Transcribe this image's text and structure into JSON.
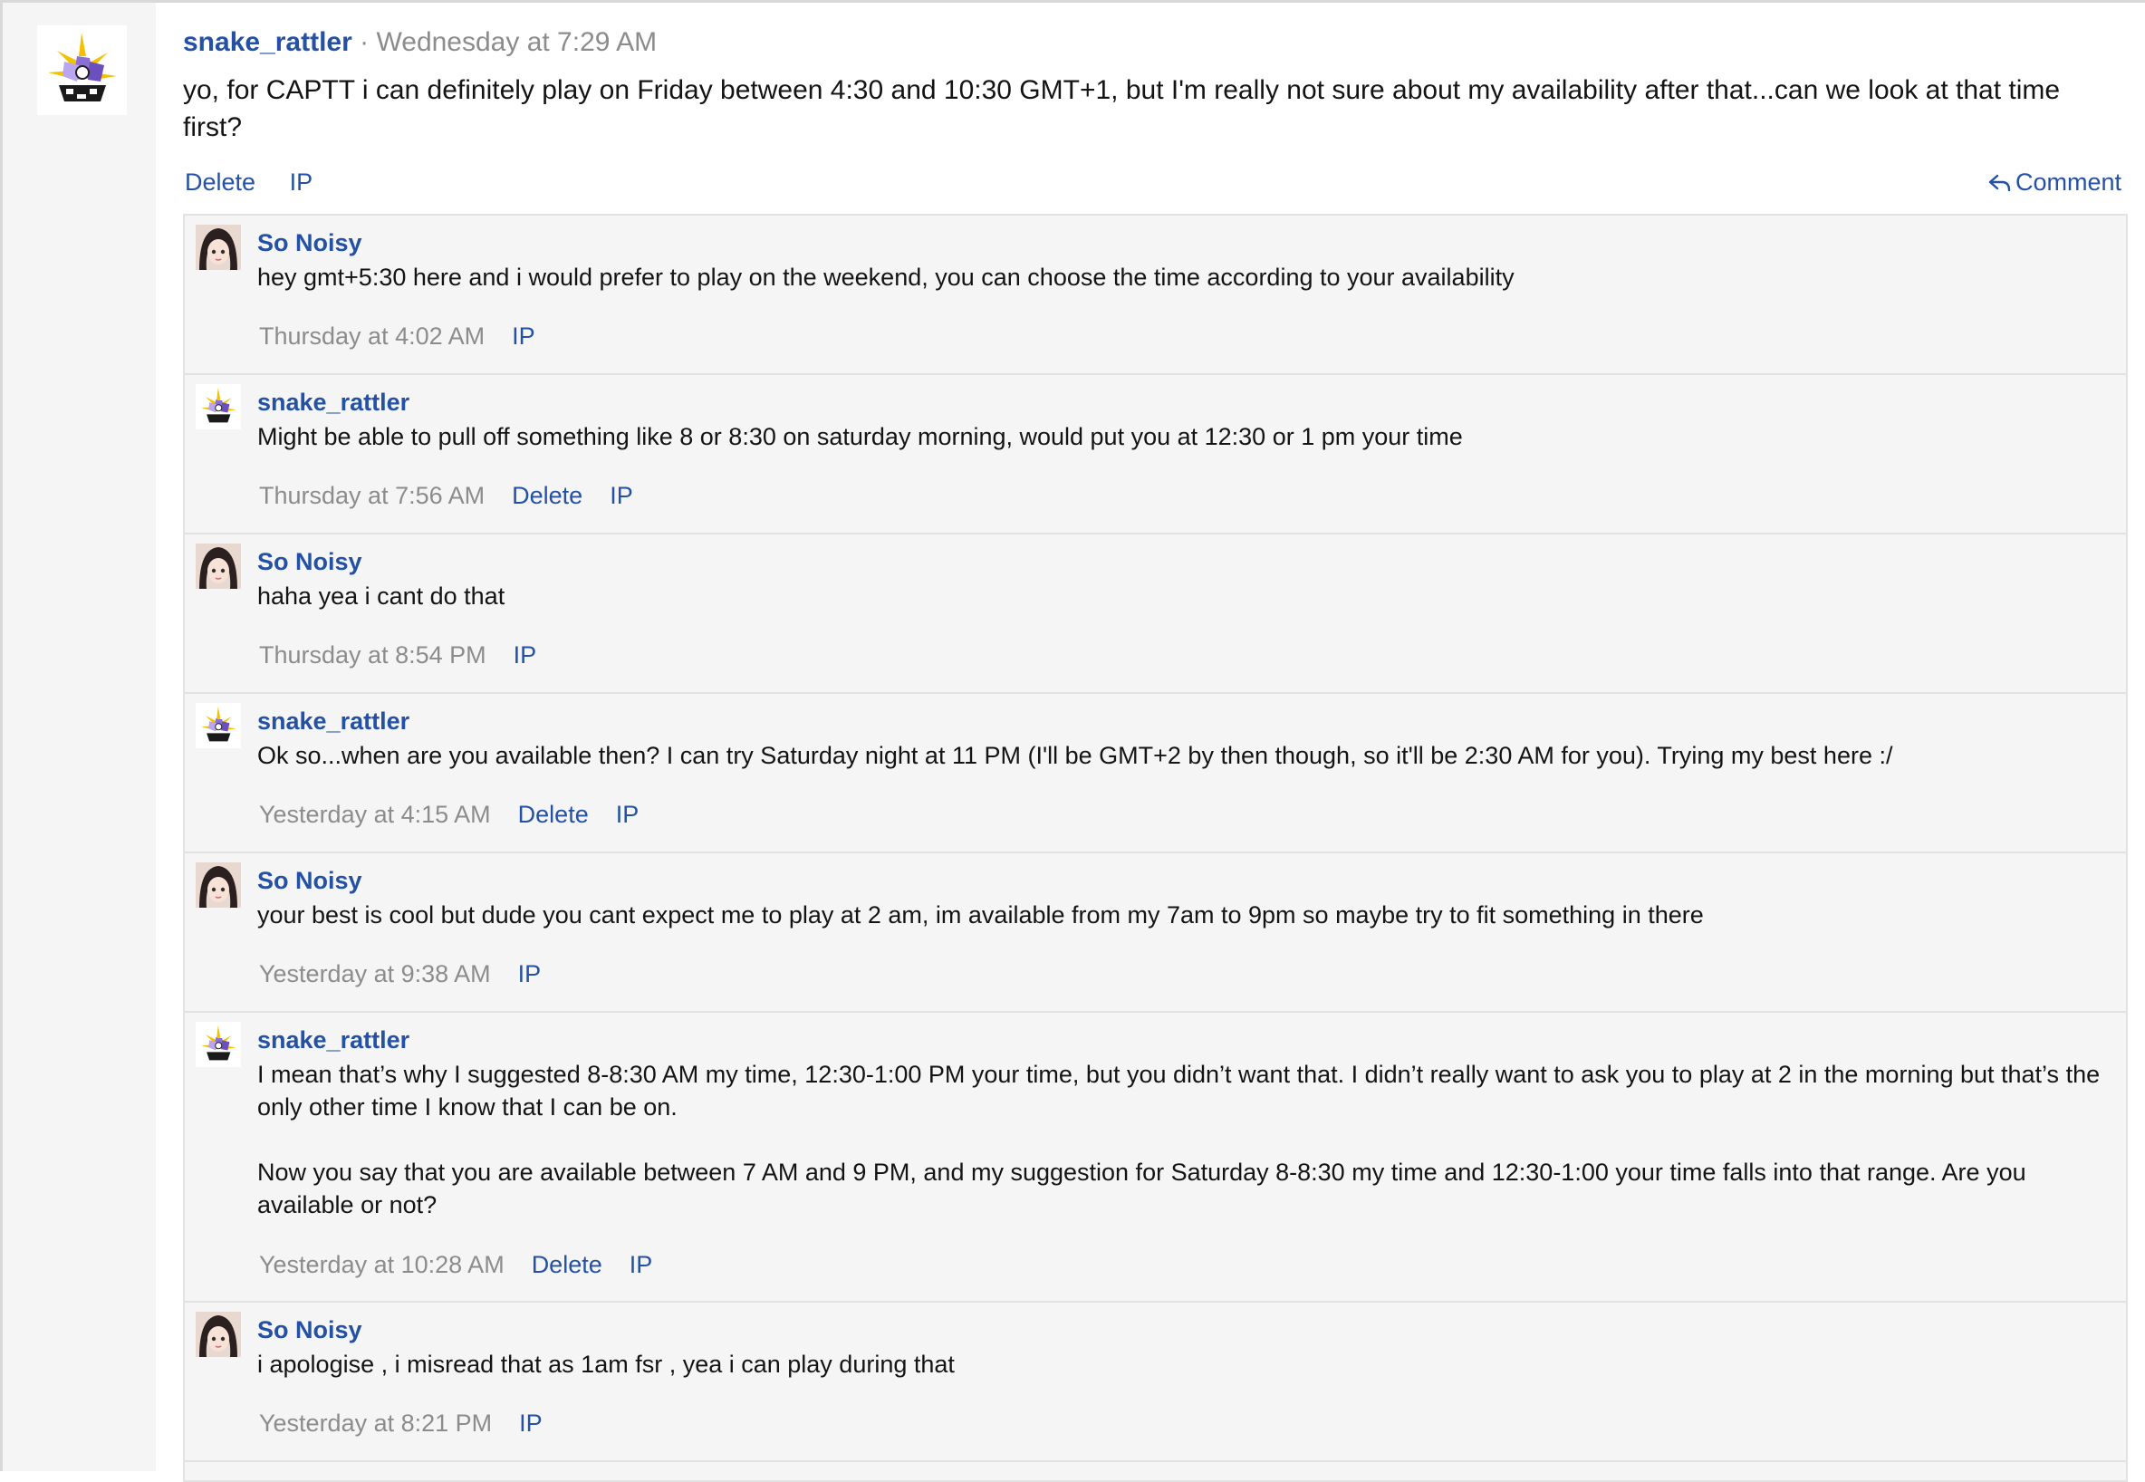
{
  "post": {
    "author": "snake_rattler",
    "separator": "·",
    "timestamp": "Wednesday at 7:29 AM",
    "text": "yo, for CAPTT i can definitely play on Friday between 4:30 and 10:30 GMT+1, but I'm really not sure about my availability after that...can we look at that time first?",
    "actions": {
      "delete": "Delete",
      "ip": "IP",
      "comment": "Comment"
    }
  },
  "comments": [
    {
      "author": "So Noisy",
      "avatar": "anime-avatar",
      "paragraphs": [
        "hey gmt+5:30 here and i would prefer to play on the weekend, you can choose the time according to your availability"
      ],
      "time": "Thursday at 4:02 AM",
      "delete": "",
      "ip": "IP"
    },
    {
      "author": "snake_rattler",
      "avatar": "jester-avatar",
      "paragraphs": [
        "Might be able to pull off something like 8 or 8:30 on saturday morning, would put you at 12:30 or 1 pm your time"
      ],
      "time": "Thursday at 7:56 AM",
      "delete": "Delete",
      "ip": "IP"
    },
    {
      "author": "So Noisy",
      "avatar": "anime-avatar",
      "paragraphs": [
        "haha yea i cant do that"
      ],
      "time": "Thursday at 8:54 PM",
      "delete": "",
      "ip": "IP"
    },
    {
      "author": "snake_rattler",
      "avatar": "jester-avatar",
      "paragraphs": [
        "Ok so...when are you available then? I can try Saturday night at 11 PM (I'll be GMT+2 by then though, so it'll be 2:30 AM for you). Trying my best here :/"
      ],
      "time": "Yesterday at 4:15 AM",
      "delete": "Delete",
      "ip": "IP"
    },
    {
      "author": "So Noisy",
      "avatar": "anime-avatar",
      "paragraphs": [
        "your best is cool but dude you cant expect me to play at 2 am, im available from my 7am to 9pm so maybe try to fit something in there"
      ],
      "time": "Yesterday at 9:38 AM",
      "delete": "",
      "ip": "IP"
    },
    {
      "author": "snake_rattler",
      "avatar": "jester-avatar",
      "paragraphs": [
        "I mean that’s why I suggested 8-8:30 AM my time, 12:30-1:00 PM your time, but you didn’t want that. I didn’t really want to ask you to play at 2 in the morning but that’s the only other time I know that I can be on.",
        "Now you say that you are available between 7 AM and 9 PM, and my suggestion for Saturday 8-8:30 my time and 12:30-1:00 your time falls into that range. Are you available or not?"
      ],
      "time": "Yesterday at 10:28 AM",
      "delete": "Delete",
      "ip": "IP"
    },
    {
      "author": "So Noisy",
      "avatar": "anime-avatar",
      "paragraphs": [
        "i apologise , i misread that as 1am fsr , yea i can play during that"
      ],
      "time": "Yesterday at 8:21 PM",
      "delete": "",
      "ip": "IP"
    }
  ],
  "colors": {
    "link": "#2451a4",
    "muted": "#8c8c8c",
    "panel": "#f5f5f5",
    "border": "#e2e2e2"
  }
}
